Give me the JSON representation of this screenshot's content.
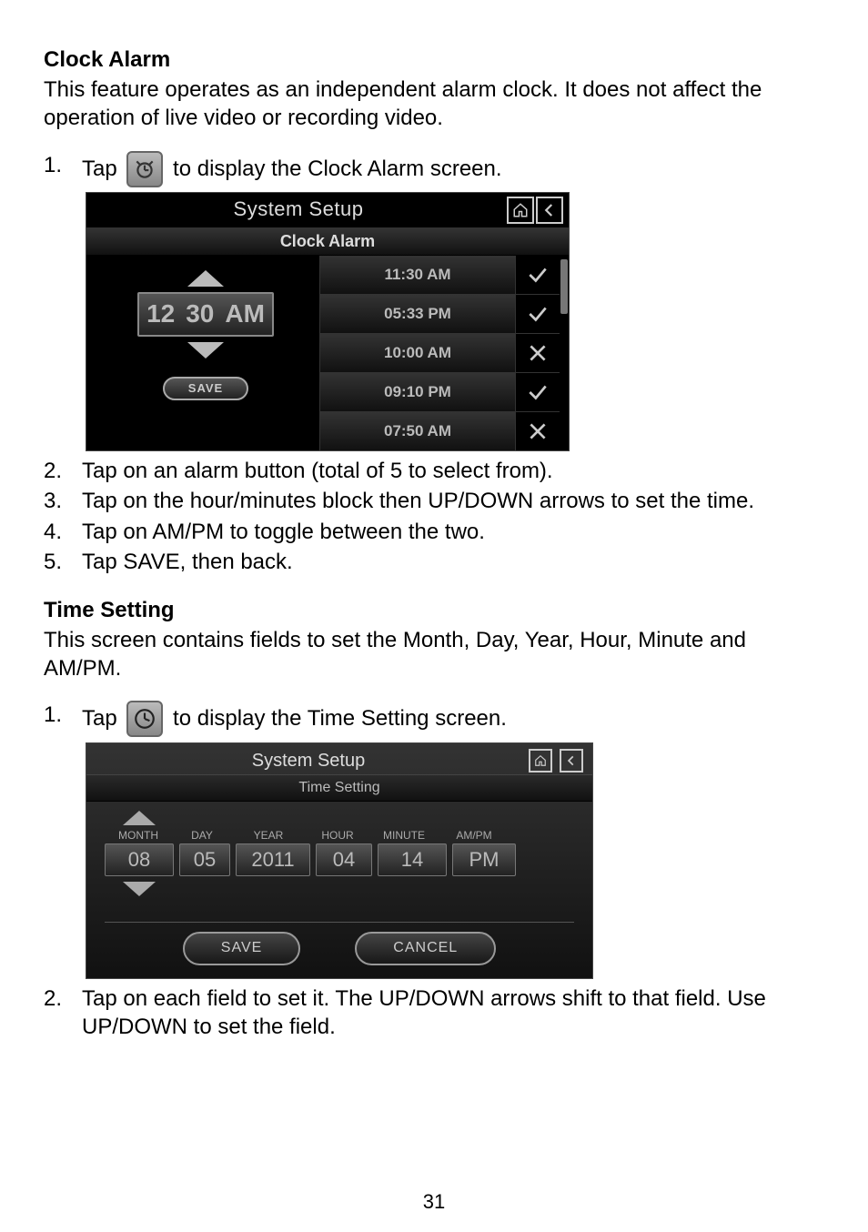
{
  "page_number": "31",
  "sections": {
    "clock_alarm": {
      "title": "Clock Alarm",
      "intro": "This feature operates as an independent alarm clock. It does not affect the operation of live video or recording video.",
      "step1_prefix": "Tap",
      "step1_suffix": "to display the Clock Alarm screen.",
      "steps_after": [
        "Tap on an alarm button (total of 5 to select from).",
        "Tap on the hour/minutes block then UP/DOWN arrows to set the time.",
        "Tap on AM/PM to toggle between the two.",
        "Tap SAVE, then back."
      ]
    },
    "time_setting": {
      "title": "Time Setting",
      "intro": "This screen contains fields to set the Month, Day, Year, Hour, Minute and AM/PM.",
      "step1_prefix": "Tap",
      "step1_suffix": "to display the Time Setting screen.",
      "steps_after": [
        "Tap on each field to set it. The UP/DOWN arrows shift to that field. Use UP/DOWN to set the field."
      ]
    }
  },
  "shot1": {
    "title": "System Setup",
    "subtitle": "Clock Alarm",
    "picker": {
      "hour": "12",
      "minute": "30",
      "ampm": "AM"
    },
    "save_label": "SAVE",
    "alarms": [
      {
        "time": "11:30 AM",
        "enabled": true
      },
      {
        "time": "05:33 PM",
        "enabled": true
      },
      {
        "time": "10:00 AM",
        "enabled": false
      },
      {
        "time": "09:10 PM",
        "enabled": true
      },
      {
        "time": "07:50 AM",
        "enabled": false
      }
    ]
  },
  "shot2": {
    "title": "System Setup",
    "subtitle": "Time Setting",
    "labels": {
      "month": "MONTH",
      "day": "DAY",
      "year": "YEAR",
      "hour": "HOUR",
      "minute": "MINUTE",
      "ampm": "AM/PM"
    },
    "values": {
      "month": "08",
      "day": "05",
      "year": "2011",
      "hour": "04",
      "minute": "14",
      "ampm": "PM"
    },
    "save_label": "SAVE",
    "cancel_label": "CANCEL"
  }
}
